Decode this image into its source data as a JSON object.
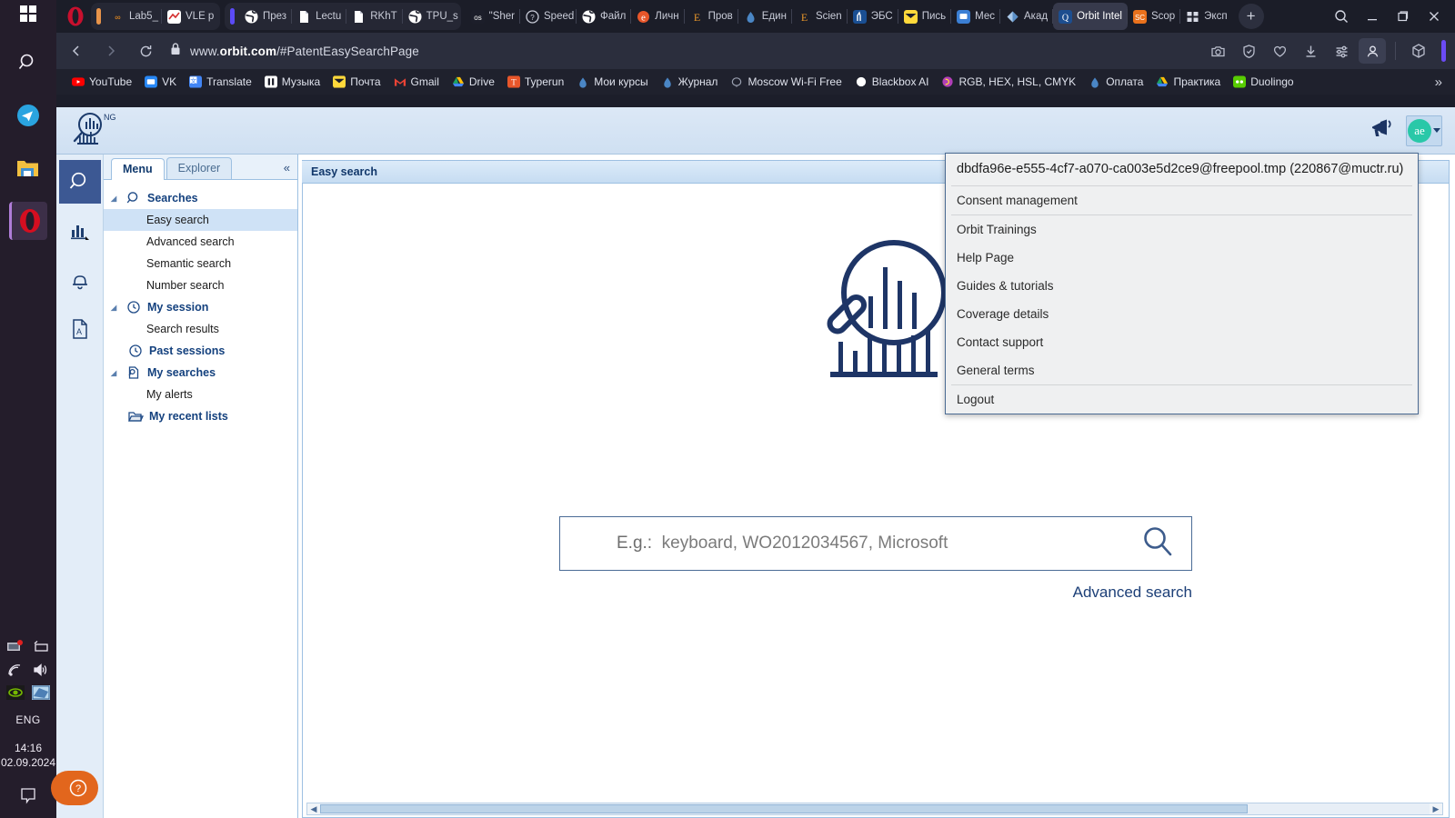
{
  "os": {
    "start_icon": "windows-start-icon",
    "taskbar_icons": [
      "search-icon",
      "telegram-icon",
      "file-explorer-icon",
      "opera-icon"
    ],
    "tray": {
      "lang": "ENG",
      "time": "14:16",
      "date": "02.09.2024",
      "icons": [
        "remote-desktop-icon",
        "battery-icon",
        "wifi-icon",
        "volume-icon",
        "nvidia-icon",
        "network-icon",
        "notifications-icon"
      ]
    }
  },
  "browser": {
    "logo": "opera-logo-icon",
    "tab_groups": [
      {
        "color": "#e8944a",
        "tabs": [
          {
            "label": "Lab5_",
            "favicon": "moodle-icon",
            "selected": false
          },
          {
            "label": "VLE p",
            "favicon": "vle-icon",
            "selected": false
          }
        ]
      },
      {
        "color": "#5b4bf7",
        "tabs": [
          {
            "label": "През",
            "favicon": "globe-icon",
            "selected": false
          },
          {
            "label": "Lectu",
            "favicon": "doc-icon",
            "selected": false
          },
          {
            "label": "RKhT",
            "favicon": "doc-icon",
            "selected": false
          },
          {
            "label": "TPU_s",
            "favicon": "globe-icon",
            "selected": false
          }
        ]
      }
    ],
    "tabs": [
      {
        "label": "\"Sher",
        "favicon": "os-icon",
        "selected": false
      },
      {
        "label": "Speed",
        "favicon": "question-icon",
        "selected": false
      },
      {
        "label": "Файл",
        "favicon": "globe-icon",
        "selected": false
      },
      {
        "label": "Личн",
        "favicon": "e-icon",
        "selected": false
      },
      {
        "label": "Пров",
        "favicon": "elibrary-icon",
        "selected": false
      },
      {
        "label": "Един",
        "favicon": "drop-icon",
        "selected": false
      },
      {
        "label": "Scien",
        "favicon": "elibrary-icon",
        "selected": false
      },
      {
        "label": "ЭБС",
        "favicon": "lama-icon",
        "selected": false
      },
      {
        "label": "Пись",
        "favicon": "mail-icon",
        "selected": false
      },
      {
        "label": "Мес",
        "favicon": "message-icon",
        "selected": false
      },
      {
        "label": "Акад",
        "favicon": "diamond-icon",
        "selected": false
      },
      {
        "label": "Orbit Intel",
        "favicon": "orbit-icon",
        "selected": true
      },
      {
        "label": "Scop",
        "favicon": "scopus-icon",
        "selected": false
      },
      {
        "label": "Эксп",
        "favicon": "grid-icon",
        "selected": false
      }
    ],
    "new_tab_label": "+",
    "window_controls": [
      "search-icon",
      "minimize-icon",
      "restore-icon",
      "close-icon"
    ],
    "nav": {
      "back": "back-arrow-icon",
      "forward": "forward-arrow-icon",
      "reload": "reload-icon",
      "lock": "padlock-icon",
      "url_prefix": "www.",
      "url_domain": "orbit.com",
      "url_suffix": "/#PatentEasySearchPage",
      "right_icons": [
        "snapshot-icon",
        "shield-icon",
        "heart-icon",
        "download-icon",
        "settings-sliders-icon",
        "profile-icon",
        "extensions-cube-icon"
      ]
    },
    "bookmarks": [
      {
        "label": "YouTube",
        "favicon": "youtube-icon"
      },
      {
        "label": "VK",
        "favicon": "vk-icon"
      },
      {
        "label": "Translate",
        "favicon": "translate-icon"
      },
      {
        "label": "Музыка",
        "favicon": "music-icon"
      },
      {
        "label": "Почта",
        "favicon": "mailru-icon"
      },
      {
        "label": "Gmail",
        "favicon": "gmail-icon"
      },
      {
        "label": "Drive",
        "favicon": "drive-icon"
      },
      {
        "label": "Typerun",
        "favicon": "typerun-icon"
      },
      {
        "label": "Мои курсы",
        "favicon": "drop-icon"
      },
      {
        "label": "Журнал",
        "favicon": "drop-icon"
      },
      {
        "label": "Moscow Wi-Fi Free",
        "favicon": "wifi-free-icon"
      },
      {
        "label": "Blackbox AI",
        "favicon": "blackbox-icon"
      },
      {
        "label": "RGB, HEX, HSL, CMYK",
        "favicon": "color-icon"
      },
      {
        "label": "Оплата",
        "favicon": "drop-icon"
      },
      {
        "label": "Практика",
        "favicon": "drive-icon"
      },
      {
        "label": "Duolingo",
        "favicon": "duolingo-icon"
      }
    ],
    "bookmarks_overflow": "»"
  },
  "app": {
    "brand_name": "orbit-intelligence-logo",
    "brand_badge": "NG",
    "header_icons": [
      "megaphone-icon",
      "avatar-button"
    ],
    "avatar_initials": "ae",
    "rail": [
      {
        "name": "search",
        "icon": "magnifier-icon",
        "selected": true
      },
      {
        "name": "analysis",
        "icon": "bar-chart-icon",
        "selected": false
      },
      {
        "name": "alerts",
        "icon": "bell-icon",
        "selected": false
      },
      {
        "name": "export-pdf",
        "icon": "pdf-icon",
        "selected": false
      }
    ],
    "help_button": "?",
    "panel": {
      "tabs": [
        {
          "label": "Menu",
          "active": true
        },
        {
          "label": "Explorer",
          "active": false
        }
      ],
      "collapse_icon": "«",
      "tree": [
        {
          "label": "Searches",
          "type": "group",
          "icon": "magnifier-icon",
          "expanded": true
        },
        {
          "label": "Easy search",
          "type": "leaf",
          "selected": true
        },
        {
          "label": "Advanced search",
          "type": "leaf",
          "selected": false
        },
        {
          "label": "Semantic search",
          "type": "leaf",
          "selected": false
        },
        {
          "label": "Number search",
          "type": "leaf",
          "selected": false
        },
        {
          "label": "My session",
          "type": "group",
          "icon": "clock-icon",
          "expanded": true
        },
        {
          "label": "Search results",
          "type": "leaf",
          "selected": false
        },
        {
          "label": "Past sessions",
          "type": "group-noarrow",
          "icon": "clock-icon",
          "expanded": false
        },
        {
          "label": "My searches",
          "type": "group",
          "icon": "saved-search-icon",
          "expanded": true
        },
        {
          "label": "My alerts",
          "type": "leaf",
          "selected": false
        },
        {
          "label": "My recent lists",
          "type": "group-noarrow",
          "icon": "folder-icon",
          "expanded": false
        }
      ]
    },
    "content": {
      "tab_title": "Easy search",
      "illustration": "magnifier-chart-illustration",
      "search_placeholder_prefix": "E.g.:",
      "search_placeholder": "keyboard, WO2012034567, Microsoft",
      "search_icon": "magnifier-icon",
      "advanced_link": "Advanced search"
    }
  },
  "account_menu": {
    "email": "dbdfa96e-e555-4cf7-a070-ca003e5d2ce9@freepool.tmp (220867@muctr.ru)",
    "items_group1": [
      "Consent management"
    ],
    "items_group2": [
      "Orbit Trainings",
      "Help Page",
      "Guides & tutorials",
      "Coverage details",
      "Contact support",
      "General terms"
    ],
    "items_group3": [
      "Logout"
    ]
  },
  "colors": {
    "accent": "#1c3f77",
    "orange": "#e2661d",
    "teal": "#29c8a8",
    "panel_blue": "#e3edf8"
  }
}
